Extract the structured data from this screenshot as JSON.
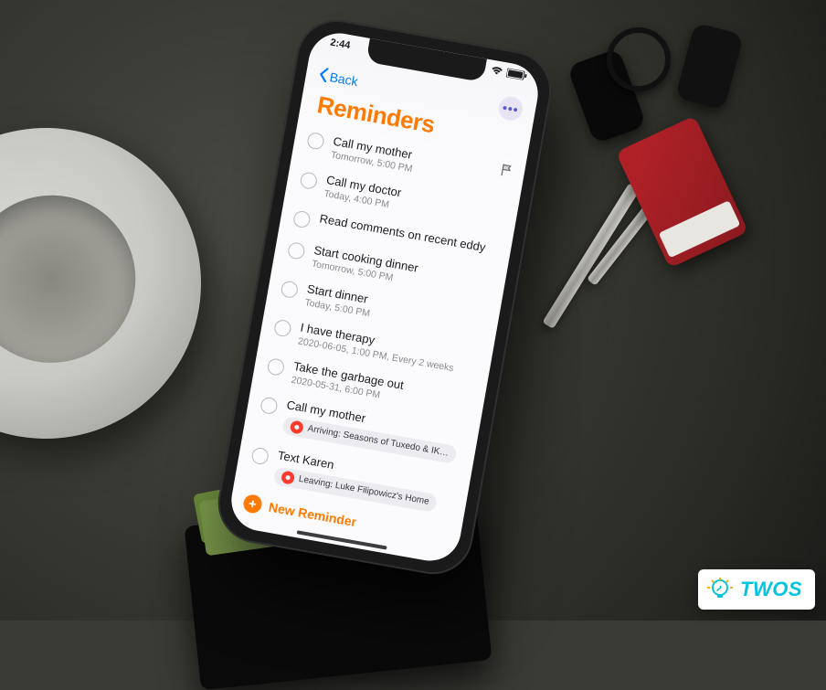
{
  "status": {
    "time": "2:44",
    "signal_icon": "signal-icon",
    "wifi_icon": "wifi-icon",
    "battery_icon": "battery-icon"
  },
  "nav": {
    "back_label": "Back",
    "more_label": "•••"
  },
  "page": {
    "title": "Reminders"
  },
  "reminders": [
    {
      "title": "Call my mother",
      "subtitle": "Tomorrow, 5:00 PM",
      "flagged": true
    },
    {
      "title": "Call my doctor",
      "subtitle": "Today, 4:00 PM",
      "flagged": false
    },
    {
      "title": "Read comments on recent eddy",
      "subtitle": "",
      "flagged": false
    },
    {
      "title": "Start cooking dinner",
      "subtitle": "Tomorrow, 5:00 PM",
      "flagged": false
    },
    {
      "title": "Start dinner",
      "subtitle": "Today, 5:00 PM",
      "flagged": false
    },
    {
      "title": "I have therapy",
      "subtitle": "2020-06-05, 1:00 PM, Every 2 weeks",
      "flagged": false
    },
    {
      "title": "Take the garbage out",
      "subtitle": "2020-05-31, 6:00 PM",
      "flagged": false
    },
    {
      "title": "Call my mother",
      "subtitle": "",
      "flagged": false,
      "pill": {
        "kind": "arriving",
        "text": "Arriving: Seasons of Tuxedo & IK…"
      }
    },
    {
      "title": "Text Karen",
      "subtitle": "",
      "flagged": false,
      "pill": {
        "kind": "leaving",
        "text": "Leaving: Luke Filipowicz's Home"
      }
    }
  ],
  "new_reminder": {
    "label": "New Reminder"
  },
  "watermark": {
    "text": "TWOS"
  },
  "colors": {
    "accent_orange": "#ff7a00",
    "ios_blue": "#007aff",
    "ios_red": "#ff3b30",
    "brand_cyan": "#05c3de"
  }
}
